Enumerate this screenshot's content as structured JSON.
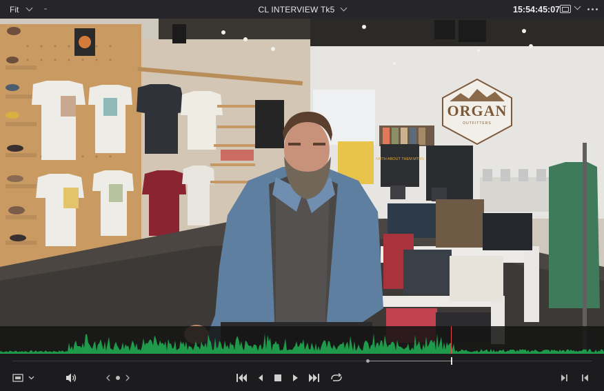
{
  "topbar": {
    "zoom_label": "Fit",
    "clip_title": "CL INTERVIEW Tk5",
    "timecode": "15:54:45:07"
  },
  "viewer": {
    "store_sign_line1": "ORGAN",
    "store_sign_line2": "OUTFITTERS",
    "poster_text": "FAITH ABOUT THEM MTNS",
    "playhead_position": 0.756
  },
  "transport": {
    "buttons": [
      "first-frame",
      "play-reverse",
      "stop",
      "play",
      "last-frame",
      "loop"
    ]
  },
  "colors": {
    "accent_waveform": "#1f9a4a",
    "playhead": "#e5484d"
  }
}
